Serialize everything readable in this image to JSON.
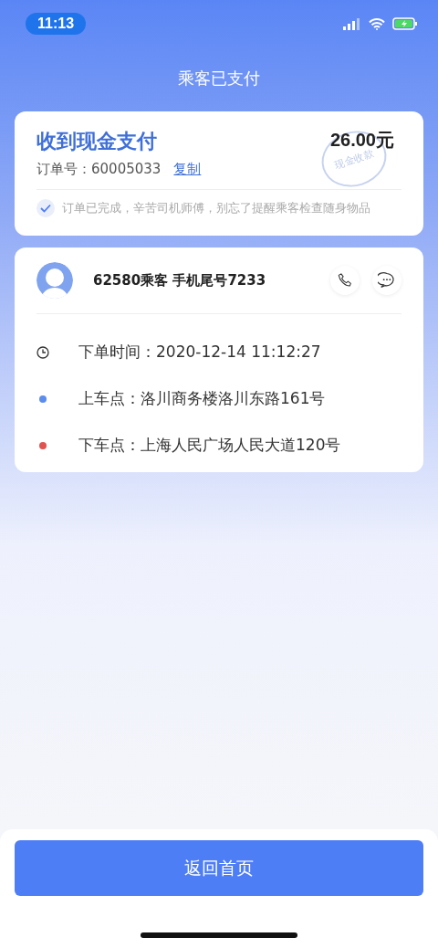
{
  "status_bar": {
    "time": "11:13"
  },
  "title": "乘客已支付",
  "payment_card": {
    "heading": "收到现金支付",
    "amount": "26.00元",
    "order_label": "订单号：60005033",
    "copy_link": "复制",
    "stamp": "现金收款",
    "notice": {
      "checked": true,
      "text": "订单已完成，辛苦司机师傅，别忘了提醒乘客检查随身物品"
    }
  },
  "trip_card": {
    "passenger": "62580乘客 手机尾号7233",
    "details": [
      {
        "kind": "time",
        "text": "下单时间：2020-12-14 11:12:27"
      },
      {
        "kind": "dot",
        "color": "#5b8def",
        "text": "上车点：洛川商务楼洛川东路161号"
      },
      {
        "kind": "dot",
        "color": "#e0534f",
        "text": "下车点：上海人民广场人民大道120号"
      }
    ]
  },
  "footer_button": "返回首页"
}
